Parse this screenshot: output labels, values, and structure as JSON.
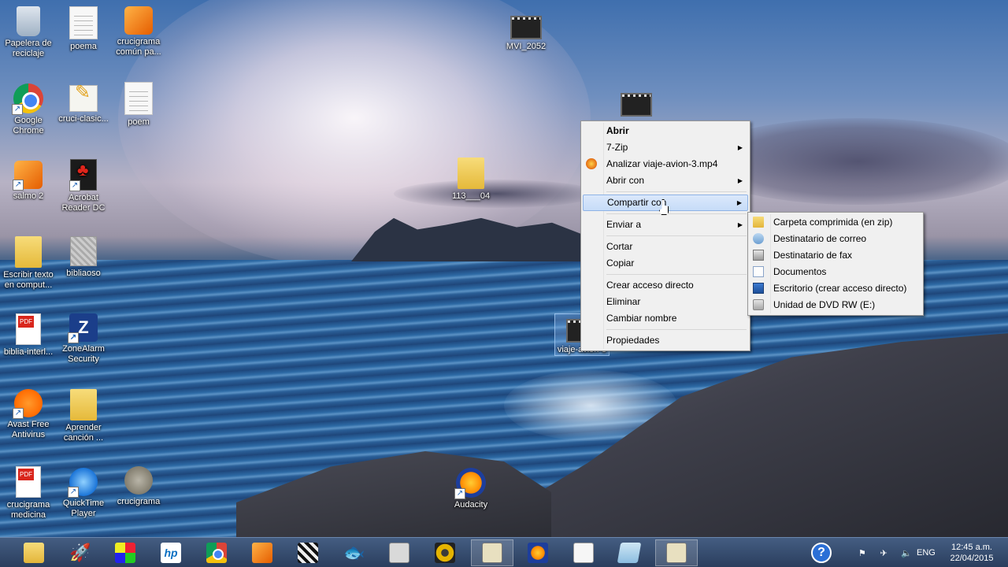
{
  "desktop": {
    "icons": [
      {
        "label": "Papelera de reciclaje",
        "icon": "recycle-bin-icon"
      },
      {
        "label": "poema",
        "icon": "text-file-icon"
      },
      {
        "label": "crucigrama común pa...",
        "icon": "wmp-video-icon"
      },
      {
        "label": "MVI_2052",
        "icon": "video-file-icon"
      },
      {
        "label": "Google Chrome",
        "icon": "chrome-icon"
      },
      {
        "label": "cruci-clasic...",
        "icon": "text-edit-icon"
      },
      {
        "label": "poem",
        "icon": "text-file-icon"
      },
      {
        "label": "salmo 2",
        "icon": "wmp-video-icon"
      },
      {
        "label": "Acrobat Reader DC",
        "icon": "acrobat-icon"
      },
      {
        "label": "113___04",
        "icon": "folder-icon"
      },
      {
        "label": "Escribir texto en comput...",
        "icon": "folder-icon"
      },
      {
        "label": "bibliaoso",
        "icon": "image-file-icon"
      },
      {
        "label": "biblia-interl...",
        "icon": "pdf-file-icon"
      },
      {
        "label": "ZoneAlarm Security",
        "icon": "zonealarm-icon"
      },
      {
        "label": "viaje-avion-3",
        "icon": "video-file-icon"
      },
      {
        "label": "Avast Free Antivirus",
        "icon": "avast-icon"
      },
      {
        "label": "Aprender canción ...",
        "icon": "folder-icon"
      },
      {
        "label": "crucigrama medicina",
        "icon": "document-icon"
      },
      {
        "label": "QuickTime Player",
        "icon": "quicktime-icon"
      },
      {
        "label": "crucigrama",
        "icon": "gimp-icon"
      },
      {
        "label": "Audacity",
        "icon": "audacity-icon"
      }
    ]
  },
  "context_menu": {
    "items": [
      {
        "label": "Abrir",
        "bold": true
      },
      {
        "label": "7-Zip",
        "submenu": true
      },
      {
        "label": "Analizar viaje-avion-3.mp4",
        "icon": "antivirus-scan-icon"
      },
      {
        "label": "Abrir con",
        "submenu": true
      },
      {
        "label": "Compartir con",
        "submenu": true,
        "highlighted": true
      },
      {
        "label": "Enviar a",
        "submenu": true
      },
      {
        "label": "Cortar"
      },
      {
        "label": "Copiar"
      },
      {
        "label": "Crear acceso directo"
      },
      {
        "label": "Eliminar"
      },
      {
        "label": "Cambiar nombre"
      },
      {
        "label": "Propiedades"
      }
    ]
  },
  "submenu": {
    "items": [
      {
        "label": "Carpeta comprimida (en zip)",
        "icon": "zip-folder-icon"
      },
      {
        "label": "Destinatario de correo",
        "icon": "mail-recipient-icon"
      },
      {
        "label": "Destinatario de fax",
        "icon": "fax-icon"
      },
      {
        "label": "Documentos",
        "icon": "documents-icon"
      },
      {
        "label": "Escritorio (crear acceso directo)",
        "icon": "desktop-icon"
      },
      {
        "label": "Unidad de DVD RW (E:)",
        "icon": "dvd-drive-icon"
      }
    ]
  },
  "taskbar": {
    "pinned": [
      {
        "icon": "file-explorer-icon",
        "active": false
      },
      {
        "icon": "rocket-icon",
        "active": false
      },
      {
        "icon": "photo-app-icon",
        "active": false
      },
      {
        "icon": "hp-icon",
        "active": false
      },
      {
        "icon": "chrome-icon",
        "active": false
      },
      {
        "icon": "wmp-icon",
        "active": false
      },
      {
        "icon": "movie-clapper-icon",
        "active": false
      },
      {
        "icon": "fish-app-icon",
        "active": false
      },
      {
        "icon": "document-app-icon",
        "active": false
      },
      {
        "icon": "speaker-app-icon",
        "active": false
      },
      {
        "icon": "map-app-icon",
        "active": true
      },
      {
        "icon": "audacity-icon",
        "active": false
      },
      {
        "icon": "notepad-icon",
        "active": false
      },
      {
        "icon": "paper-app-icon",
        "active": false
      },
      {
        "icon": "map-cancel-app-icon",
        "active": true
      }
    ],
    "hp_label": "hp",
    "tray": {
      "language": "ENG",
      "time": "12:45 a.m.",
      "date": "22/04/2015"
    }
  },
  "colors": {
    "menu_bg": "#f0f0f0",
    "menu_highlight": "#c6dcf8",
    "taskbar": "#2e4a74"
  }
}
